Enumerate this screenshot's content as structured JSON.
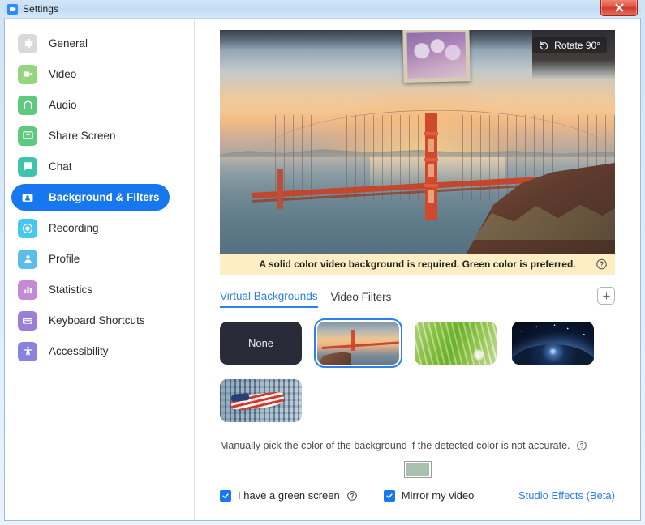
{
  "window": {
    "title": "Settings",
    "logo_icon": "zoom-logo-icon",
    "close_label": "✕"
  },
  "sidebar": {
    "items": [
      {
        "label": "General",
        "icon": "gear-icon",
        "active": false
      },
      {
        "label": "Video",
        "icon": "camera-icon",
        "active": false
      },
      {
        "label": "Audio",
        "icon": "headphones-icon",
        "active": false
      },
      {
        "label": "Share Screen",
        "icon": "share-screen-icon",
        "active": false
      },
      {
        "label": "Chat",
        "icon": "chat-bubble-icon",
        "active": false
      },
      {
        "label": "Background & Filters",
        "icon": "person-card-icon",
        "active": true
      },
      {
        "label": "Recording",
        "icon": "record-circle-icon",
        "active": false
      },
      {
        "label": "Profile",
        "icon": "person-icon",
        "active": false
      },
      {
        "label": "Statistics",
        "icon": "bar-chart-icon",
        "active": false
      },
      {
        "label": "Keyboard Shortcuts",
        "icon": "keyboard-icon",
        "active": false
      },
      {
        "label": "Accessibility",
        "icon": "accessibility-icon",
        "active": false
      }
    ]
  },
  "preview": {
    "rotate_label": "Rotate 90°",
    "rotate_icon": "rotate-ccw-icon",
    "description": "Golden Gate Bridge at sunset video preview with picture frame overlay"
  },
  "notice": {
    "text": "A solid color video background is required. Green color is preferred.",
    "help_icon": "question-circle-icon",
    "background_color": "#fdefc3"
  },
  "tabs": [
    {
      "label": "Virtual Backgrounds",
      "active": true
    },
    {
      "label": "Video Filters",
      "active": false
    }
  ],
  "add_button": {
    "icon": "plus-icon"
  },
  "backgrounds": [
    {
      "label": "None",
      "type": "none",
      "selected": false
    },
    {
      "label": "Golden Gate Bridge",
      "type": "gate",
      "selected": true
    },
    {
      "label": "Grass",
      "type": "grass",
      "selected": false
    },
    {
      "label": "Earth from space",
      "type": "space",
      "selected": false
    },
    {
      "label": "American flag",
      "type": "flag",
      "selected": false
    }
  ],
  "manual_pick": {
    "text": "Manually pick the color of the background if the detected color is not accurate.",
    "help_icon": "question-circle-icon"
  },
  "color_swatch": {
    "value": "#a8c0ae"
  },
  "bottom": {
    "green_screen": {
      "label": "I have a green screen",
      "checked": true,
      "help_icon": "question-circle-icon"
    },
    "mirror_video": {
      "label": "Mirror my video",
      "checked": true
    },
    "studio_effects": {
      "label": "Studio Effects (Beta)"
    }
  },
  "colors": {
    "accent": "#1677ef",
    "link": "#2d7ff0",
    "notice_bg": "#fdefc3",
    "swatch": "#a8c0ae"
  }
}
